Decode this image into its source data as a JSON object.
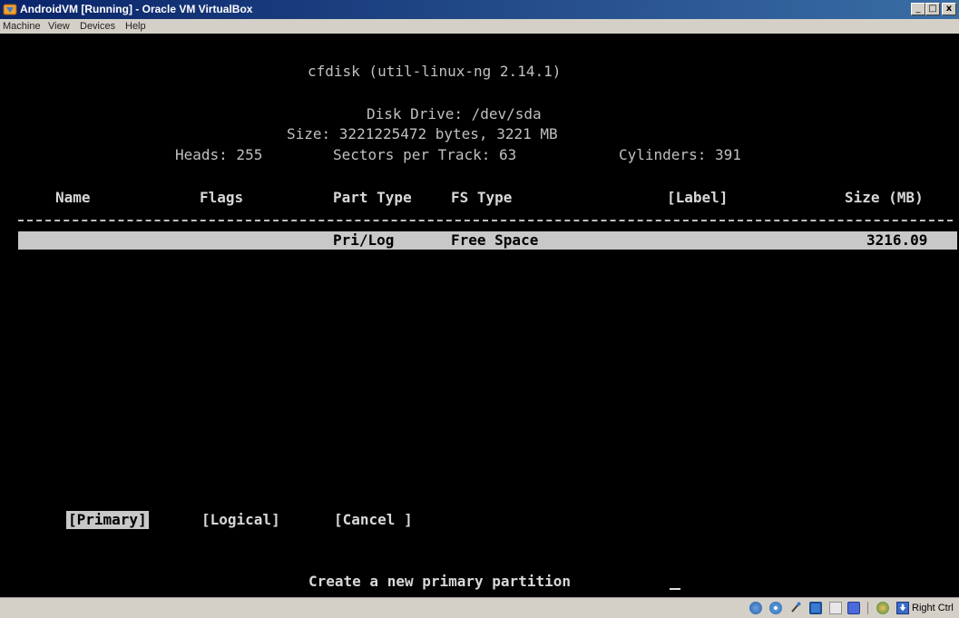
{
  "window": {
    "title": "AndroidVM [Running] - Oracle VM VirtualBox",
    "min_label": "_",
    "max_label": "□",
    "close_label": "x"
  },
  "menubar": {
    "items": [
      "Machine",
      "View",
      "Devices",
      "Help"
    ]
  },
  "cfdisk": {
    "header": "cfdisk (util-linux-ng 2.14.1)",
    "disk_drive": "Disk Drive: /dev/sda",
    "size_line": "Size: 3221225472 bytes, 3221 MB",
    "heads": "Heads: 255",
    "sectors": "Sectors per Track: 63",
    "cylinders": "Cylinders: 391",
    "columns": [
      "Name",
      "Flags",
      "Part Type",
      "FS Type",
      "[Label]",
      "Size (MB)"
    ],
    "rows": [
      {
        "name": "",
        "flags": "",
        "part_type": "Pri/Log",
        "fs_type": "Free Space",
        "label": "",
        "size": "3216.09"
      }
    ],
    "buttons": {
      "primary": "[Primary]",
      "logical": "[Logical]",
      "cancel": "[Cancel ]"
    },
    "status": "Create a new primary partition"
  },
  "statusbar": {
    "icons": [
      "hard-disk-icon",
      "optical-drive-icon",
      "usb-icon",
      "network-icon",
      "shared-folders-icon",
      "vrdp-icon",
      "mouse-integration-icon",
      "host-key-icon"
    ],
    "host_key": "Right Ctrl"
  }
}
